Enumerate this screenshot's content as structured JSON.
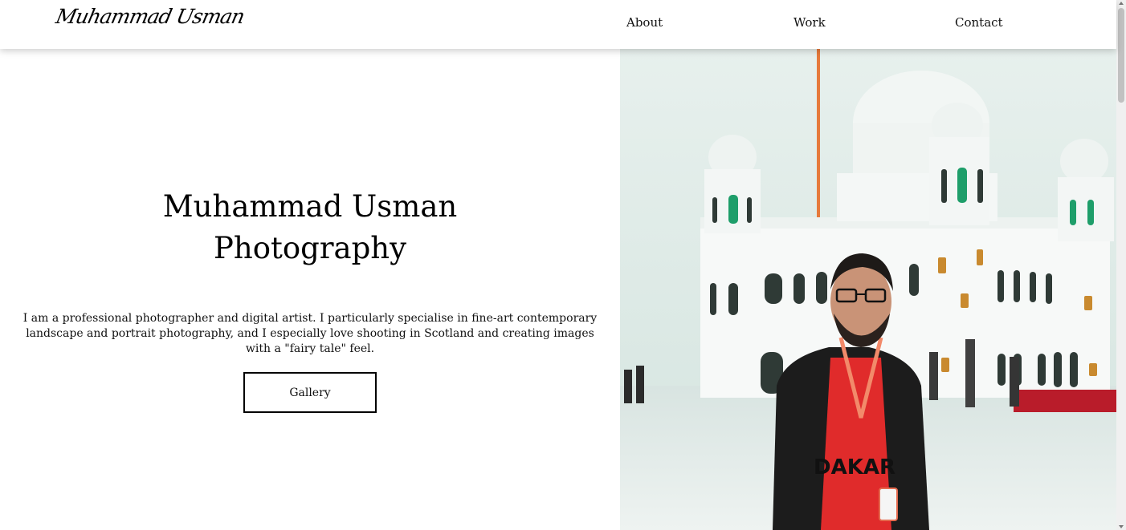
{
  "nav": {
    "logo": "Muhammad Usman",
    "links": [
      "About",
      "Work",
      "Contact"
    ]
  },
  "hero": {
    "title_line1": "Muhammad Usman",
    "title_line2": "Photography",
    "description": "I am a professional photographer and digital artist. I particularly specialise in fine-art contemporary landscape and portrait photography, and I especially love shooting in Scotland and creating images with a \"fairy tale\" feel.",
    "button_label": "Gallery"
  },
  "photo": {
    "badge_text": "DAKAR",
    "shirt_color": "#e02b2b",
    "building_color": "#f7f9f8"
  }
}
